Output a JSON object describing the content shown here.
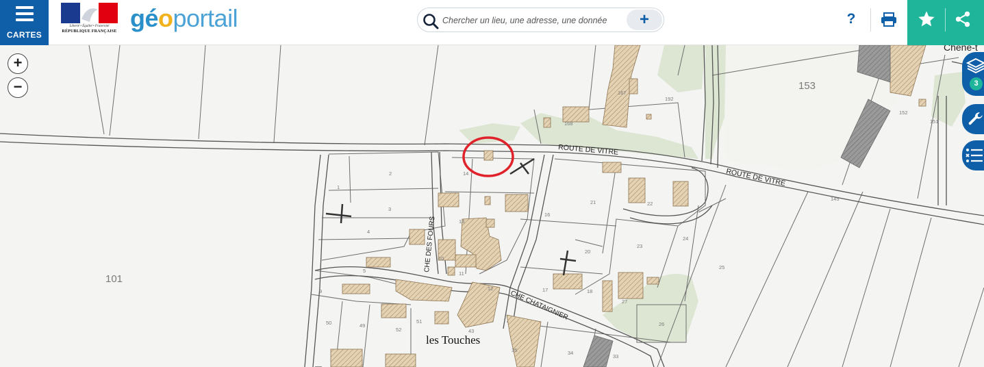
{
  "header": {
    "menu_label": "CARTES",
    "logo_motto": "Liberté • Égalité • Fraternité",
    "logo_republic": "RÉPUBLIQUE FRANÇAISE",
    "brand_geo_1": "gé",
    "brand_geo_2": "o",
    "brand_rest": "portail",
    "search_placeholder": "Chercher un lieu, une adresse, une donnée",
    "search_add": "+",
    "help_label": "?"
  },
  "map_controls": {
    "zoom_in": "+",
    "zoom_out": "−",
    "layer_count": "3"
  },
  "map": {
    "roads": [
      "ROUTE DE VITRE",
      "ROUTE DE VITRE",
      "CHE DES FOURS",
      "CHE CHATAIGNIER"
    ],
    "place_name": "les Touches",
    "edge_label": "Chêne-t",
    "large_parcels": [
      "101",
      "153"
    ],
    "small_parcels": [
      "167",
      "192",
      "168",
      "152",
      "151",
      "2",
      "3",
      "1",
      "4",
      "14",
      "13",
      "10",
      "11",
      "5",
      "9",
      "12",
      "16",
      "21",
      "22",
      "20",
      "23",
      "24",
      "25",
      "17",
      "18",
      "27",
      "26",
      "50",
      "49",
      "52",
      "51",
      "43",
      "35",
      "34",
      "33",
      "145"
    ]
  },
  "colors": {
    "header_blue": "#0f5ea8",
    "brand_blue": "#2a90c9",
    "brand_yellow": "#f2b21b",
    "teal": "#1fb59a",
    "map_background": "#f4f4f2",
    "building_fill": "#dcc9a8",
    "vegetation": "#dde6d3",
    "highlight_circle": "#e0232b"
  },
  "icons": [
    "menu-icon",
    "search-icon",
    "plus-icon",
    "help-icon",
    "print-icon",
    "star-icon",
    "share-icon",
    "layers-icon",
    "wrench-icon",
    "legend-list-icon"
  ]
}
